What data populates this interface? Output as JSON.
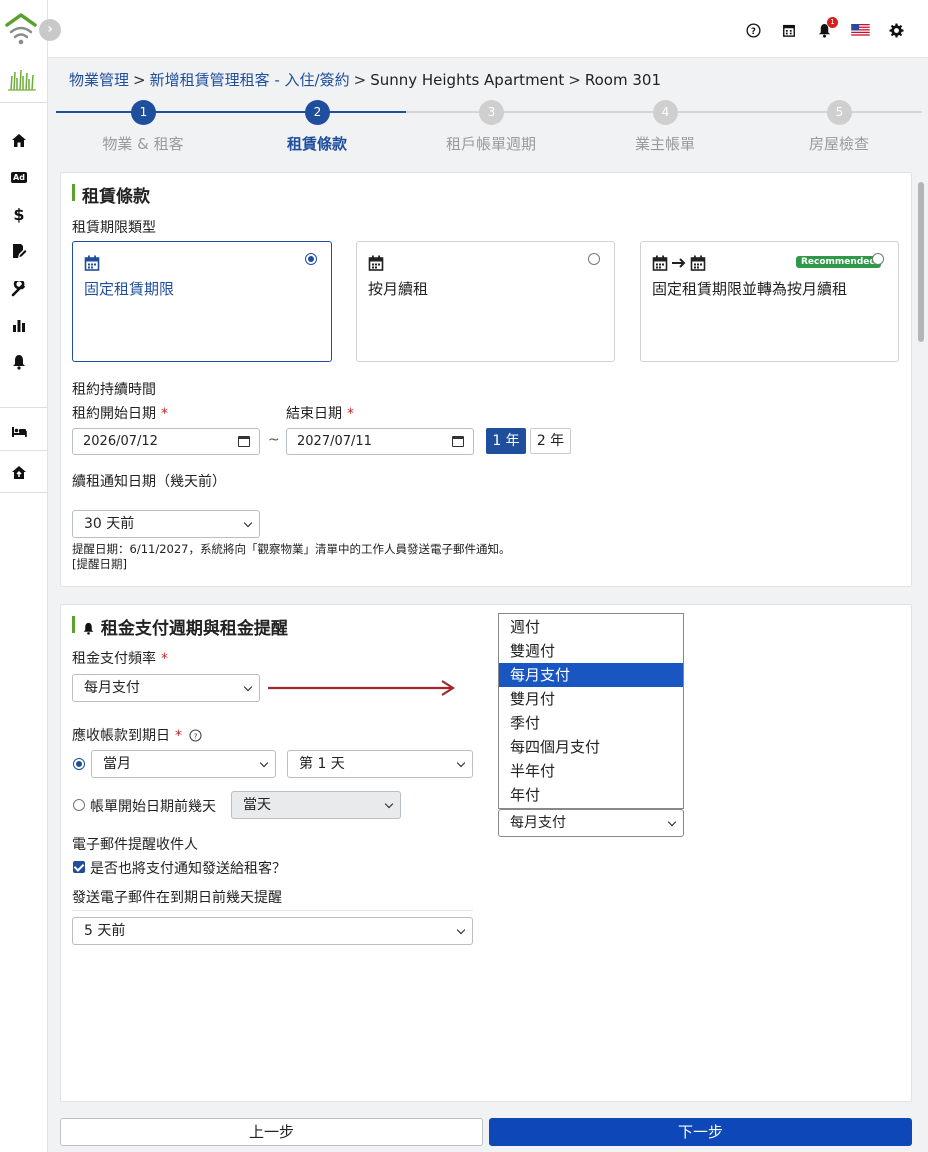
{
  "topbar": {
    "help_icon": "question-circle-icon",
    "calendar_icon": "calendar-icon",
    "notifications": {
      "icon": "bell-icon",
      "count": "1"
    },
    "language_icon": "us-flag-icon",
    "settings_icon": "gear-icon"
  },
  "sidebar": {
    "items": [
      {
        "icon": "home-icon"
      },
      {
        "icon": "ad-icon",
        "text": "Ad"
      },
      {
        "icon": "dollar-icon",
        "text": "$"
      },
      {
        "icon": "edit-document-icon"
      },
      {
        "icon": "wrench-icon"
      },
      {
        "icon": "bar-chart-icon"
      },
      {
        "icon": "bell-icon"
      },
      {
        "icon": "bed-icon"
      },
      {
        "icon": "house-up-icon"
      }
    ]
  },
  "breadcrumb": [
    "物業管理",
    "新增租賃管理租客 - 入住/簽約",
    "Sunny Heights Apartment",
    "Room 301"
  ],
  "stepper": {
    "steps": [
      {
        "num": "1",
        "label": "物業 & 租客",
        "state": "done"
      },
      {
        "num": "2",
        "label": "租賃條款",
        "state": "current"
      },
      {
        "num": "3",
        "label": "租戶帳單週期",
        "state": "todo"
      },
      {
        "num": "4",
        "label": "業主帳單",
        "state": "todo"
      },
      {
        "num": "5",
        "label": "房屋檢查",
        "state": "todo"
      }
    ]
  },
  "lease": {
    "section_title": "租賃條款",
    "term_type_label": "租賃期限類型",
    "options": [
      {
        "title": "固定租賃期限",
        "selected": true
      },
      {
        "title": "按月續租",
        "selected": false
      },
      {
        "title": "固定租賃期限並轉為按月續租",
        "badge": "Recommended",
        "selected": false
      }
    ],
    "duration_label": "租約持續時間",
    "start_label": "租約開始日期",
    "end_label": "結束日期",
    "required_mark": "*",
    "start_value": "2026/07/12",
    "end_value": "2027/07/11",
    "range_sep": "~",
    "year_buttons": [
      {
        "label": "1 年",
        "active": true
      },
      {
        "label": "2 年",
        "active": false
      }
    ],
    "renewal_label": "續租通知日期（幾天前）",
    "renewal_value": "30 天前",
    "note_line1": "提醒日期：6/11/2027，系統將向「觀察物業」清單中的工作人員發送電子郵件通知。",
    "note_line2": "[提醒日期]"
  },
  "rent": {
    "section_title": "租金支付週期與租金提醒",
    "bell_icon": "bell-icon",
    "freq_label": "租金支付頻率",
    "freq_value": "每月支付",
    "due_label": "應收帳款到期日",
    "due_help_icon": "question-circle-icon",
    "due_month_value": "當月",
    "due_day_value": "第 1 天",
    "before_label": "帳單開始日期前幾天",
    "before_value": "當天",
    "email_label": "電子郵件提醒收件人",
    "send_tenant_label": "是否也將支付通知發送給租客？",
    "send_tenant_checked": true,
    "remind_label": "發送電子郵件在到期日前幾天提醒",
    "remind_value": "5 天前",
    "dropdown_options": [
      "週付",
      "雙週付",
      "每月支付",
      "雙月付",
      "季付",
      "每四個月支付",
      "半年付",
      "年付"
    ],
    "dropdown_selected": "每月支付",
    "dropdown_select_value": "每月支付"
  },
  "footer": {
    "prev_label": "上一步",
    "next_label": "下一步"
  },
  "colors": {
    "primary": "#1f4e9c",
    "accent_green": "#5aa02c",
    "required": "#c62828",
    "arrow": "#a4262c",
    "dropdown_highlight": "#1a56c2",
    "next_button": "#0d47b8"
  }
}
